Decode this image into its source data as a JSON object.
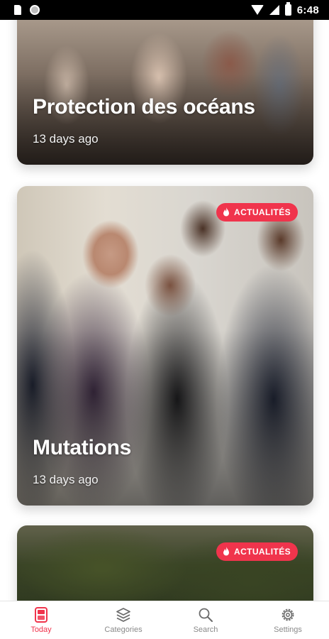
{
  "status_bar": {
    "time": "6:48"
  },
  "cards": [
    {
      "title": "Protection des océans",
      "meta": "13 days ago",
      "badge": ""
    },
    {
      "title": "Mutations",
      "meta": "13 days ago",
      "badge": "ACTUALITÉS"
    },
    {
      "title": "",
      "meta": "",
      "badge": "ACTUALITÉS"
    }
  ],
  "bottom_nav": {
    "items": [
      {
        "label": "Today",
        "icon": "today-icon",
        "active": true
      },
      {
        "label": "Categories",
        "icon": "stack-icon",
        "active": false
      },
      {
        "label": "Search",
        "icon": "search-icon",
        "active": false
      },
      {
        "label": "Settings",
        "icon": "gear-icon",
        "active": false
      }
    ]
  },
  "colors": {
    "accent": "#f0344c",
    "inactive": "#8a8a8a"
  }
}
